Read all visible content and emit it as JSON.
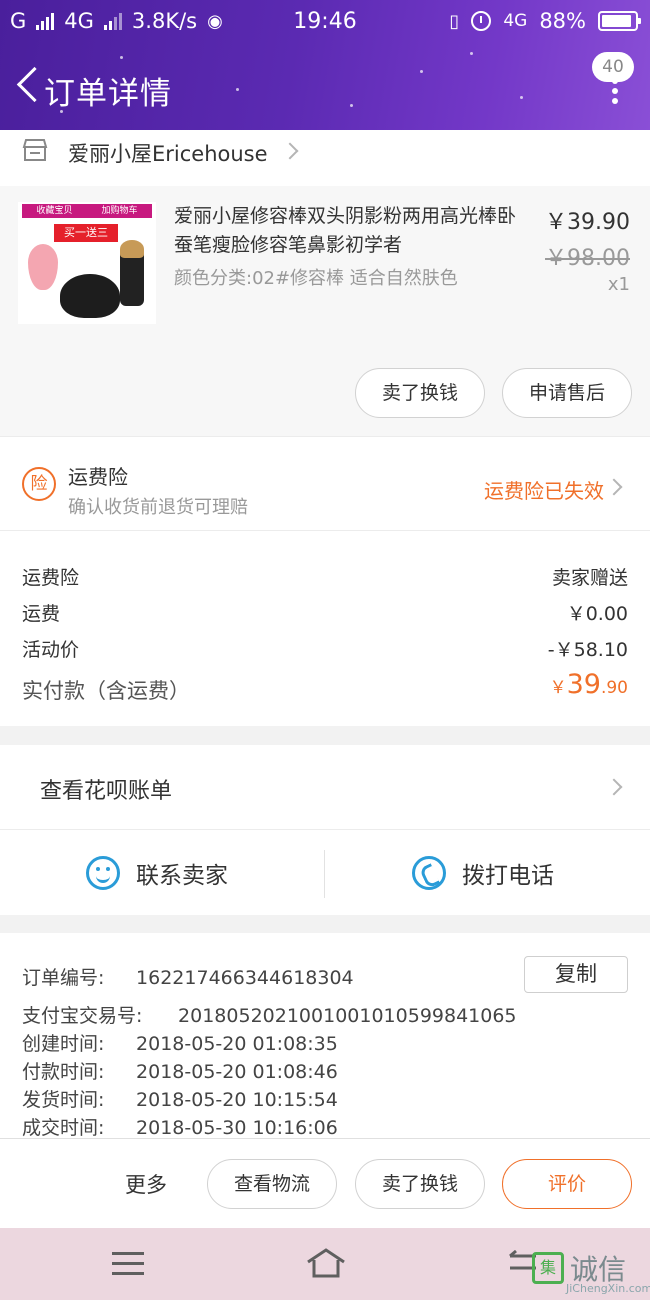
{
  "status_bar": {
    "carrier": "G",
    "network": "4G",
    "speed": "3.8K/s",
    "time": "19:46",
    "network2": "4G",
    "battery": "88%"
  },
  "header": {
    "title": "订单详情",
    "badge_count": "40"
  },
  "shop": {
    "name": "爱丽小屋Ericehouse"
  },
  "product": {
    "name": "爱丽小屋修容棒双头阴影粉两用高光棒卧蚕笔瘦脸修容笔鼻影初学者",
    "spec": "颜色分类:02#修容棒 适合自然肤色",
    "price": "￥39.90",
    "original_price": "￥98.00",
    "quantity": "x1",
    "thumb_bar_left": "收藏宝贝",
    "thumb_bar_right": "加购物车",
    "thumb_promo": "买一送三",
    "btn_sell": "卖了换钱",
    "btn_aftersale": "申请售后"
  },
  "insurance": {
    "icon_char": "险",
    "title": "运费险",
    "subtitle": "确认收货前退货可理赔",
    "status": "运费险已失效"
  },
  "fees": {
    "rows": [
      {
        "label": "运费险",
        "value": "卖家赠送"
      },
      {
        "label": "运费",
        "value": "￥0.00"
      },
      {
        "label": "活动价",
        "value": "-￥58.10"
      }
    ],
    "total_label": "实付款（含运费）",
    "total_currency": "￥",
    "total_int": "39",
    "total_dec": ".90"
  },
  "huabei": {
    "label": "查看花呗账单"
  },
  "contact": {
    "seller": "联系卖家",
    "phone": "拨打电话"
  },
  "order_info": {
    "order_no_label": "订单编号:",
    "order_no": "162217466344618304",
    "copy": "复制",
    "rows": [
      {
        "label": "支付宝交易号:",
        "value": "2018052021001001010599841065"
      },
      {
        "label": "创建时间:",
        "value": "2018-05-20 01:08:35"
      },
      {
        "label": "付款时间:",
        "value": "2018-05-20 01:08:46"
      },
      {
        "label": "发货时间:",
        "value": "2018-05-20 10:15:54"
      },
      {
        "label": "成交时间:",
        "value": "2018-05-30 10:16:06"
      }
    ]
  },
  "actions": {
    "more": "更多",
    "logistics": "查看物流",
    "sell": "卖了换钱",
    "review": "评价"
  },
  "watermark": {
    "logo_char": "集",
    "main": "诚信",
    "sub": "JiChengXin.com"
  },
  "colors": {
    "header_purple": "#5b2ab2",
    "accent_orange": "#f0702a",
    "link_blue": "#2a9cd8"
  }
}
